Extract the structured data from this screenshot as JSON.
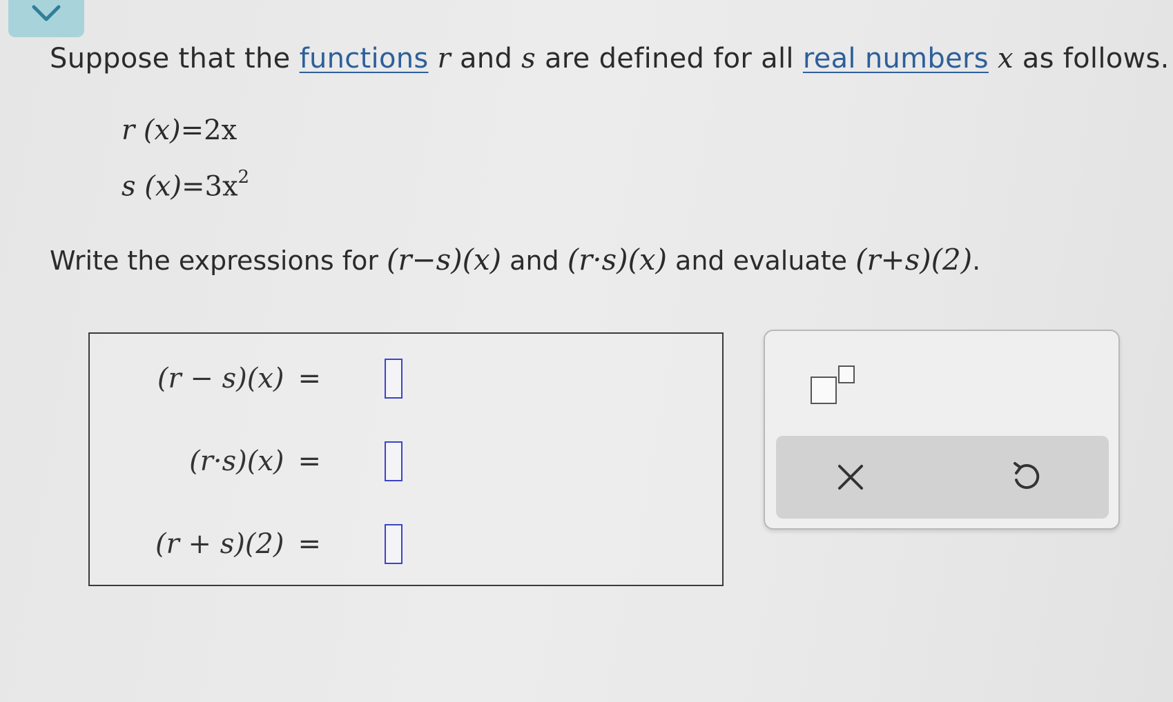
{
  "prompt": {
    "part1": "Suppose that the ",
    "link_functions": "functions",
    "var_r": "r",
    "part2": " and ",
    "var_s": "s",
    "part3": " are defined for all ",
    "link_real_numbers": "real numbers",
    "var_x": "x",
    "part4": " as follows."
  },
  "definitions": {
    "r_lhs": "r (x)",
    "r_rhs": "=2x",
    "s_lhs": "s (x)",
    "s_rhs": "=3x",
    "s_exp": "2"
  },
  "question": {
    "part1": "Write the expressions for ",
    "expr1": "(r−s)(x)",
    "part2": " and ",
    "expr2": "(r·s)(x)",
    "part3": " and evaluate ",
    "expr3": "(r+s)(2)",
    "part4": "."
  },
  "answers": [
    {
      "label": "(r − s)(x)",
      "equals": "=",
      "value": ""
    },
    {
      "label": "(r·s)(x)",
      "equals": "=",
      "value": ""
    },
    {
      "label": "(r + s)(2)",
      "equals": "=",
      "value": ""
    }
  ],
  "tools": {
    "exponent_tool": "superscript-template-icon",
    "clear_icon": "close-icon",
    "undo_icon": "undo-icon"
  },
  "colors": {
    "accent_tab": "#a9d3da",
    "link": "#2d5f9a",
    "input_border": "#3b43c9"
  }
}
